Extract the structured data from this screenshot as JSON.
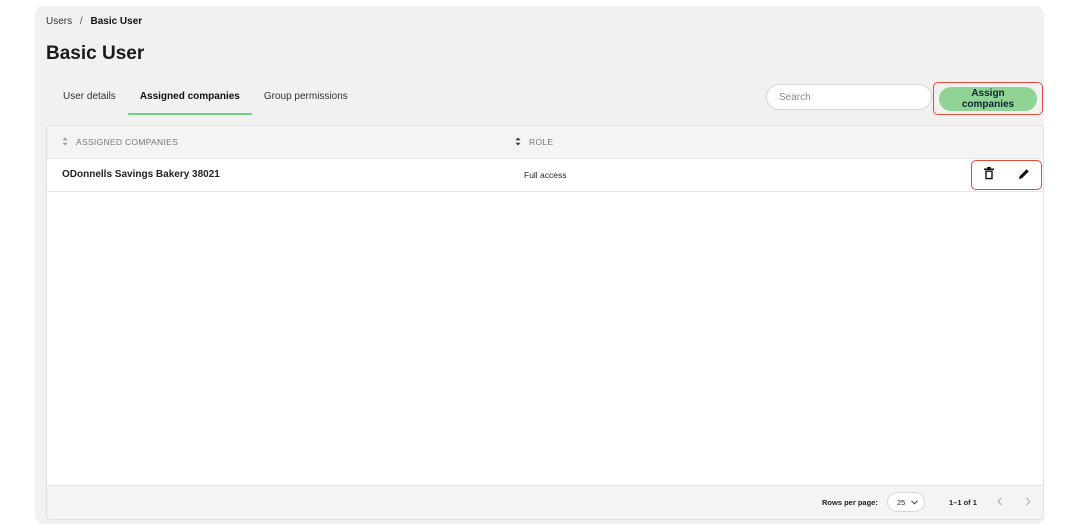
{
  "breadcrumb": {
    "root": "Users",
    "separator": "/",
    "current": "Basic User"
  },
  "page": {
    "title": "Basic User"
  },
  "tabs": [
    {
      "label": "User details",
      "active": false
    },
    {
      "label": "Assigned companies",
      "active": true
    },
    {
      "label": "Group permissions",
      "active": false
    }
  ],
  "search": {
    "placeholder": "Search",
    "value": ""
  },
  "toolbar": {
    "assign_label": "Assign companies"
  },
  "table": {
    "columns": [
      "ASSIGNED COMPANIES",
      "ROLE"
    ],
    "rows": [
      {
        "company": "ODonnells Savings Bakery 38021",
        "role": "Full access"
      }
    ]
  },
  "pagination": {
    "rows_per_page_label": "Rows per page:",
    "rows_per_page_value": "25",
    "range": "1–1 of 1"
  },
  "colors": {
    "accent": "#8fd494",
    "active_tab_underline": "#6fcf80",
    "highlight_border": "#e24a3b"
  }
}
